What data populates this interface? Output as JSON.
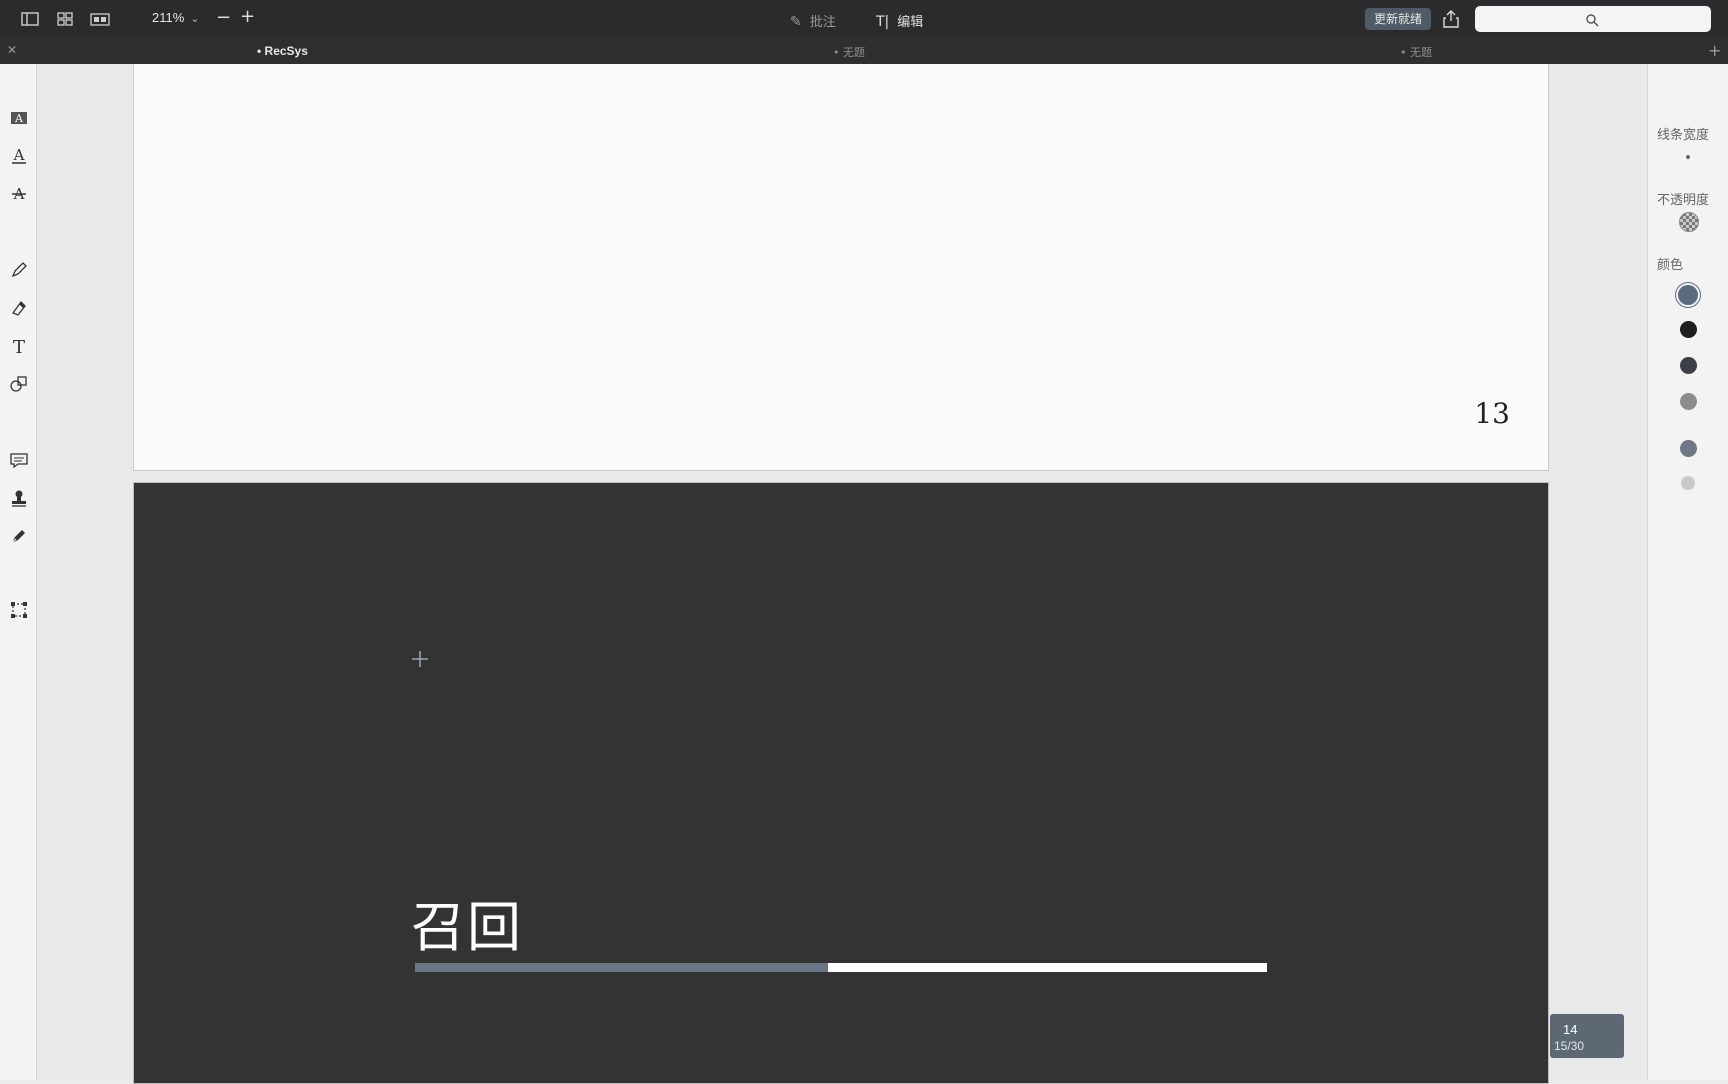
{
  "toolbar": {
    "zoom_label": "211%",
    "zoom_chevron": "⌄",
    "zoom_out": "−",
    "zoom_in": "+",
    "annotate_label": "批注",
    "annotate_glyph": "✎",
    "edit_label": "编辑",
    "edit_glyph": "T|",
    "update_label": "更新就绪",
    "search_placeholder": ""
  },
  "tabs": {
    "close_glyph": "✕",
    "items": [
      {
        "label": "• RecSys",
        "active": true
      },
      {
        "label": "• 无题",
        "active": false
      },
      {
        "label": "• 无题",
        "active": false
      }
    ],
    "add_glyph": "+"
  },
  "left_tools": [
    {
      "icon": "text-highlight-icon"
    },
    {
      "icon": "text-underline-icon"
    },
    {
      "icon": "text-strikethrough-icon"
    },
    {
      "icon": "pencil-icon"
    },
    {
      "icon": "eraser-icon"
    },
    {
      "icon": "text-tool-icon"
    },
    {
      "icon": "shapes-icon"
    },
    {
      "icon": "comment-icon"
    },
    {
      "icon": "stamp-icon"
    },
    {
      "icon": "pen-icon"
    },
    {
      "icon": "selection-icon"
    }
  ],
  "document": {
    "page13_number": "13",
    "page14_title": "召回",
    "progress_fraction": 0.485
  },
  "page_indicator": {
    "current": "14",
    "total": "15/30"
  },
  "properties": {
    "line_width_label": "线条宽度",
    "opacity_label": "不透明度",
    "color_label": "颜色",
    "colors": [
      "#5a6b7d",
      "#1e1e1e",
      "#3a3f48",
      "#8d8d8d",
      "#6f7884",
      "#c9c9c9"
    ],
    "accent": "#5d6874"
  }
}
